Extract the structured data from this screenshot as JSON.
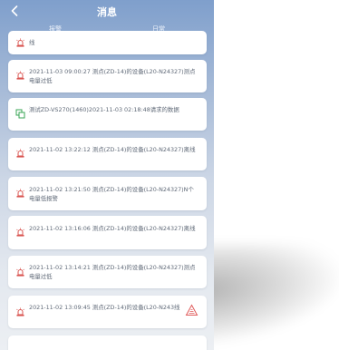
{
  "header": {
    "back_icon": "chevron-left-icon",
    "title": "消息"
  },
  "tabs": [
    {
      "label": "报警",
      "active": true
    },
    {
      "label": "日常",
      "active": false
    }
  ],
  "messages": [
    {
      "icon": "alarm-siren-icon",
      "color": "#d9534f",
      "text": "线"
    },
    {
      "icon": "alarm-siren-icon",
      "color": "#d9534f",
      "text": "2021-11-03 09:00:27 测点(ZD-14)的设备(L20-N24327)测点电量过低"
    },
    {
      "icon": "device-copy-icon",
      "color": "#3aa655",
      "text": "测试ZD-VS270(1460)2021-11-03 02:18:48请求的数据"
    },
    {
      "icon": "alarm-siren-icon",
      "color": "#d9534f",
      "text": "2021-11-02 13:22:12 测点(ZD-14)的设备(L20-N24327)离线"
    },
    {
      "icon": "alarm-siren-icon",
      "color": "#d9534f",
      "text": "2021-11-02 13:21:50 测点(ZD-14)的设备(L20-N24327)N个电量低报警"
    },
    {
      "icon": "alarm-siren-icon",
      "color": "#d9534f",
      "text": "2021-11-02 13:16:06 测点(ZD-14)的设备(L20-N24327)离线"
    },
    {
      "icon": "alarm-siren-icon",
      "color": "#d9534f",
      "text": "2021-11-02 13:14:21 测点(ZD-14)的设备(L20-N24327)测点电量过低"
    },
    {
      "icon": "alarm-siren-icon",
      "color": "#d9534f",
      "text": "2021-11-02 13:09:45 测点(ZD-14)的设备(L20-N243线"
    }
  ],
  "badge": {
    "icon": "processed-stamp-icon",
    "color": "#e05a5a"
  }
}
